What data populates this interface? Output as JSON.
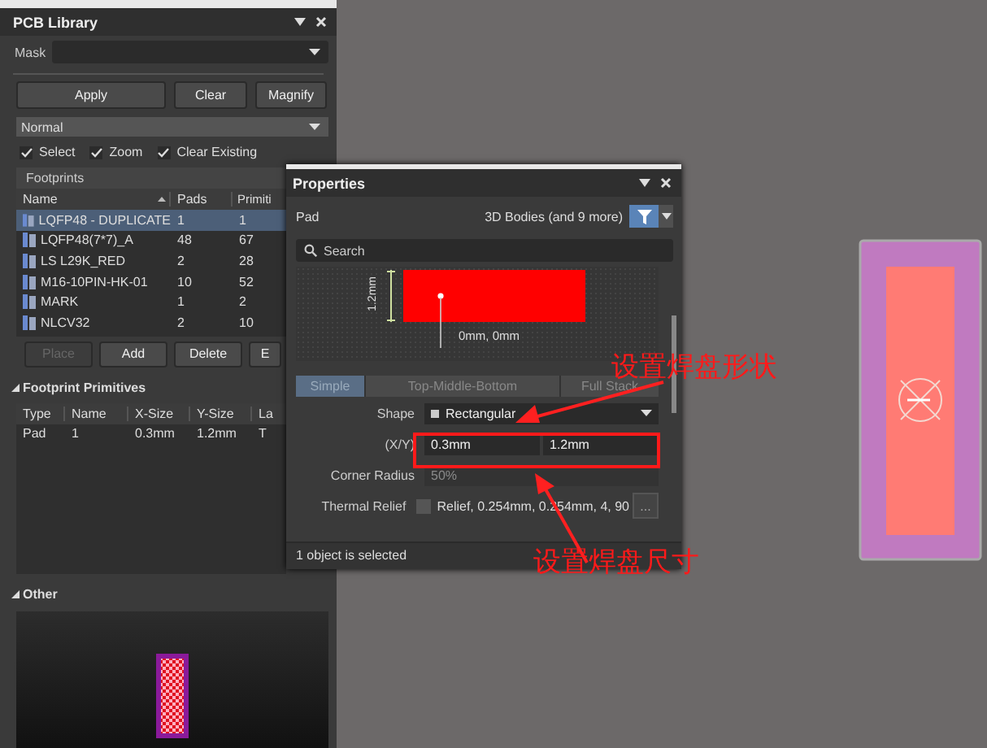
{
  "pcb_library": {
    "title": "PCB Library",
    "mask": {
      "label": "Mask"
    },
    "buttons": [
      {
        "label": "Apply"
      },
      {
        "label": "Clear"
      },
      {
        "label": "Magnify"
      }
    ],
    "mode": "Normal",
    "options": [
      {
        "label": "Select",
        "checked": true
      },
      {
        "label": "Zoom",
        "checked": true
      },
      {
        "label": "Clear Existing",
        "checked": true
      }
    ],
    "footprints": {
      "title": "Footprints",
      "columns": [
        "Name",
        "Pads",
        "Primiti"
      ],
      "rows": [
        {
          "cells": [
            "LQFP48 - DUPLICATE",
            "1",
            "1"
          ],
          "selected": true
        },
        {
          "cells": [
            "LQFP48(7*7)_A",
            "48",
            "67"
          ],
          "selected": false
        },
        {
          "cells": [
            "LS L29K_RED",
            "2",
            "28"
          ],
          "selected": false
        },
        {
          "cells": [
            "M16-10PIN-HK-01",
            "10",
            "52"
          ],
          "selected": false
        },
        {
          "cells": [
            "MARK",
            "1",
            "2"
          ],
          "selected": false
        },
        {
          "cells": [
            "NLCV32",
            "2",
            "10"
          ],
          "selected": false
        }
      ],
      "actions": [
        {
          "label": "Place",
          "disabled": true
        },
        {
          "label": "Add",
          "disabled": false
        },
        {
          "label": "Delete",
          "disabled": false
        },
        {
          "label": "E",
          "disabled": false
        }
      ]
    },
    "primitives": {
      "title": "Footprint Primitives",
      "columns": [
        "Type",
        "Name",
        "X-Size",
        "Y-Size",
        "La"
      ],
      "rows": [
        [
          "Pad",
          "1",
          "0.3mm",
          "1.2mm",
          "T"
        ]
      ]
    },
    "other": {
      "title": "Other"
    }
  },
  "properties": {
    "title": "Properties",
    "object": "Pad",
    "filter_label": "3D Bodies (and 9 more)",
    "search": {
      "placeholder": "Search"
    },
    "preview": {
      "height_label": "1.2mm",
      "origin_label": "0mm, 0mm"
    },
    "tabs": [
      {
        "label": "Simple",
        "selected": true
      },
      {
        "label": "Top-Middle-Bottom",
        "selected": false
      },
      {
        "label": "Full Stack",
        "selected": false
      }
    ],
    "fields": [
      {
        "kind": "select",
        "label": "Shape",
        "value": "Rectangular"
      },
      {
        "kind": "pair",
        "label": "(X/Y)",
        "values": [
          "0.3mm",
          "1.2mm"
        ]
      },
      {
        "kind": "text",
        "label": "Corner Radius",
        "value": "50%",
        "disabled": true
      },
      {
        "kind": "check",
        "label": "Thermal Relief",
        "checked": false,
        "value": "Relief, 0.254mm, 0.254mm, 4, 90",
        "button": "..."
      }
    ],
    "status": "1 object is selected"
  },
  "annotations": [
    {
      "text": "设置焊盘形状"
    },
    {
      "text": "设置焊盘尺寸"
    }
  ]
}
